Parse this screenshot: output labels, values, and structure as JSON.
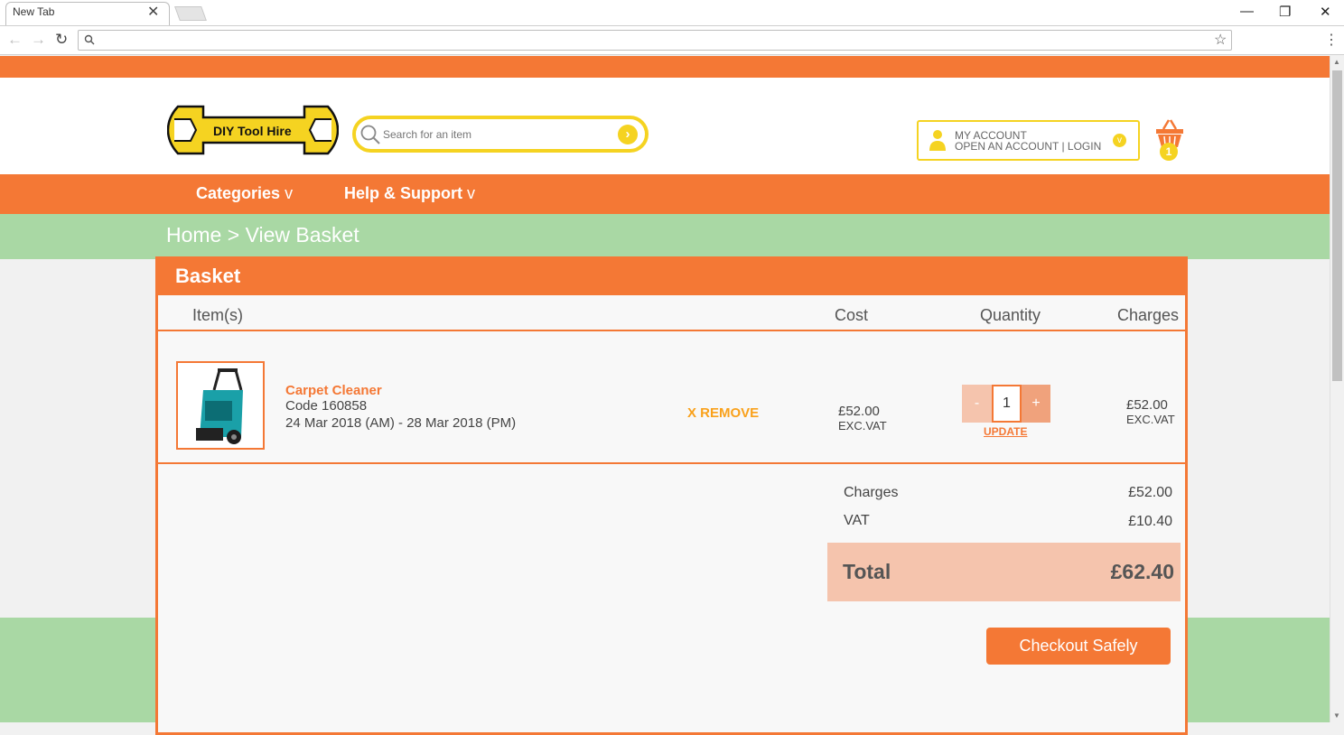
{
  "browser": {
    "tab_title": "New Tab",
    "tab_close": "✕",
    "url": ""
  },
  "header": {
    "logo_text": "DIY Tool Hire",
    "search_placeholder": "Search for an item",
    "account_line1": "MY ACCOUNT",
    "account_line2": "OPEN AN ACCOUNT | LOGIN",
    "cart_count": "1"
  },
  "nav": {
    "categories": "Categories",
    "help": "Help & Support",
    "chevron": "v"
  },
  "breadcrumb": "Home > View Basket",
  "basket": {
    "title": "Basket",
    "columns": [
      "Item(s)",
      "Cost",
      "Quantity",
      "Charges"
    ],
    "items": [
      {
        "name": "Carpet Cleaner",
        "code": "Code 160858",
        "dates": "24 Mar 2018 (AM) - 28 Mar 2018 (PM)",
        "remove_label": "X REMOVE",
        "cost": "£52.00",
        "cost_note": "EXC.VAT",
        "quantity": "1",
        "minus": "-",
        "plus": "+",
        "update_label": "UPDATE",
        "charges": "£52.00",
        "charges_note": "EXC.VAT"
      }
    ],
    "summary": {
      "charges_label": "Charges",
      "charges_value": "£52.00",
      "vat_label": "VAT",
      "vat_value": "£10.40",
      "total_label": "Total",
      "total_value": "£62.40"
    },
    "checkout_label": "Checkout Safely"
  },
  "colors": {
    "orange": "#f47835",
    "yellow": "#f5d321",
    "green": "#a9d8a4"
  }
}
